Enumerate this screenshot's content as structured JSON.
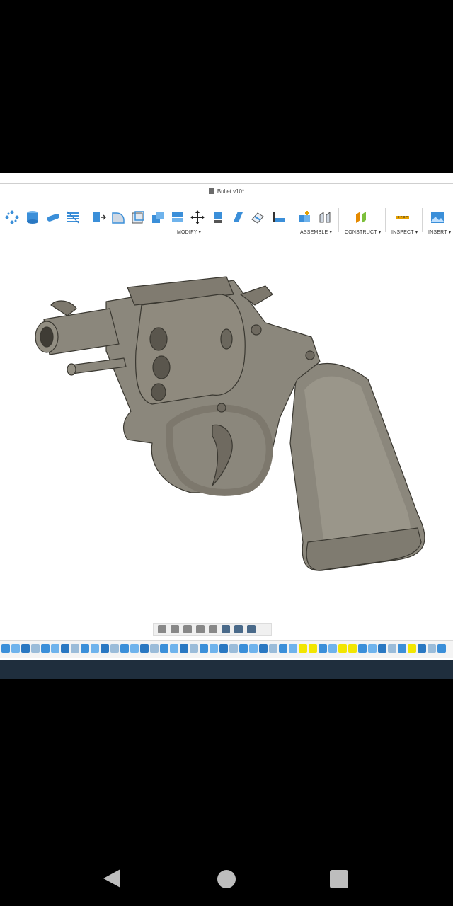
{
  "document": {
    "title": "Bullet v10*"
  },
  "toolbar": {
    "groups": [
      {
        "label": "MODIFY ▾"
      },
      {
        "label": "ASSEMBLE ▾"
      },
      {
        "label": "CONSTRUCT ▾"
      },
      {
        "label": "INSPECT ▾"
      },
      {
        "label": "INSERT ▾"
      }
    ]
  },
  "colors": {
    "accent": "#3b8fd9",
    "model_fill": "#8a8577",
    "timeline_highlight": "#f2e600",
    "taskbar": "#1f2e3d"
  },
  "android_nav": {
    "back": "back-icon",
    "home": "home-icon",
    "recents": "recents-icon"
  }
}
